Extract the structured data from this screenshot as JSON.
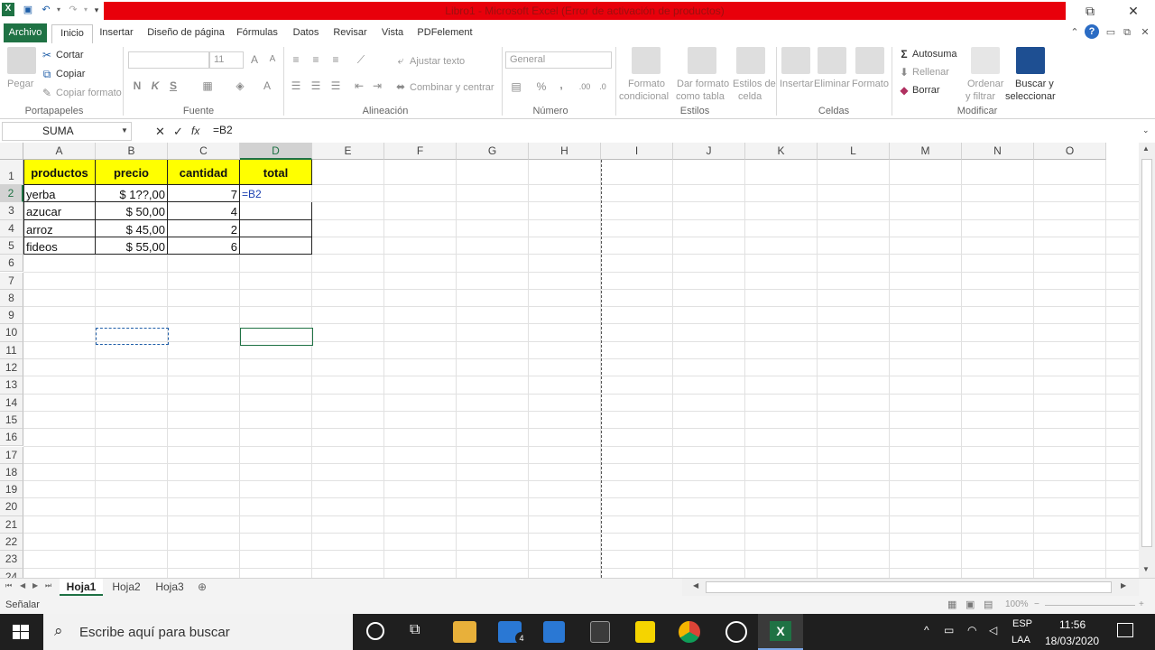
{
  "window": {
    "title": "Libro1 - Microsoft Excel (Error de activación de productos)",
    "restore_glyph": "⧉",
    "close_glyph": "✕"
  },
  "tabs": [
    "Archivo",
    "Inicio",
    "Insertar",
    "Diseño de página",
    "Fórmulas",
    "Datos",
    "Revisar",
    "Vista",
    "PDFelement"
  ],
  "ribbon": {
    "clipboard": {
      "paste": "Pegar",
      "cut": "Cortar",
      "copy": "Copiar",
      "format_painter": "Copiar formato",
      "label": "Portapapeles"
    },
    "font": {
      "size": "11",
      "bold": "N",
      "italic": "K",
      "underline": "S",
      "label": "Fuente"
    },
    "alignment": {
      "wrap": "Ajustar texto",
      "merge": "Combinar y centrar",
      "label": "Alineación"
    },
    "number": {
      "format": "General",
      "percent": "%",
      "comma": ",",
      "label": "Número"
    },
    "styles": {
      "conditional_1": "Formato",
      "conditional_2": "condicional",
      "table_1": "Dar formato",
      "table_2": "como tabla",
      "cell_1": "Estilos de",
      "cell_2": "celda",
      "label": "Estilos"
    },
    "cells": {
      "insert": "Insertar",
      "delete": "Eliminar",
      "format": "Formato",
      "label": "Celdas"
    },
    "editing": {
      "autosum": "Autosuma",
      "fill": "Rellenar",
      "clear": "Borrar",
      "sort_1": "Ordenar",
      "sort_2": "y filtrar",
      "find_1": "Buscar y",
      "find_2": "seleccionar",
      "label": "Modificar"
    }
  },
  "formula_bar": {
    "name_box": "SUMA",
    "fx": "fx",
    "formula": "=B2"
  },
  "columns": [
    "A",
    "B",
    "C",
    "D",
    "E",
    "F",
    "G",
    "H",
    "I",
    "J",
    "K",
    "L",
    "M",
    "N",
    "O"
  ],
  "rows": [
    "1",
    "2",
    "3",
    "4",
    "5",
    "6",
    "7",
    "8",
    "9",
    "10",
    "11",
    "12",
    "13",
    "14",
    "15",
    "16",
    "17",
    "18",
    "19",
    "20",
    "21",
    "22",
    "23",
    "24"
  ],
  "table": {
    "headers": [
      "productos",
      "precio",
      "cantidad",
      "total"
    ],
    "rows": [
      [
        "yerba",
        "$ 1??,00",
        "7",
        "=B2"
      ],
      [
        "azucar",
        "$ 50,00",
        "4",
        ""
      ],
      [
        "arroz",
        "$ 45,00",
        "2",
        ""
      ],
      [
        "fideos",
        "$ 55,00",
        "6",
        ""
      ]
    ],
    "header_fill": "#ffff00"
  },
  "sheets": [
    "Hoja1",
    "Hoja2",
    "Hoja3"
  ],
  "status": {
    "mode": "Señalar",
    "zoom": "100%"
  },
  "taskbar": {
    "search_placeholder": "Escribe aquí para buscar",
    "mail_badge": "4",
    "lang_1": "ESP",
    "lang_2": "LAA",
    "time": "11:56",
    "date": "18/03/2020"
  },
  "colors": {
    "excel_green": "#1f7244",
    "title_red": "#e8000b",
    "taskbar": "#1f1f1f"
  }
}
